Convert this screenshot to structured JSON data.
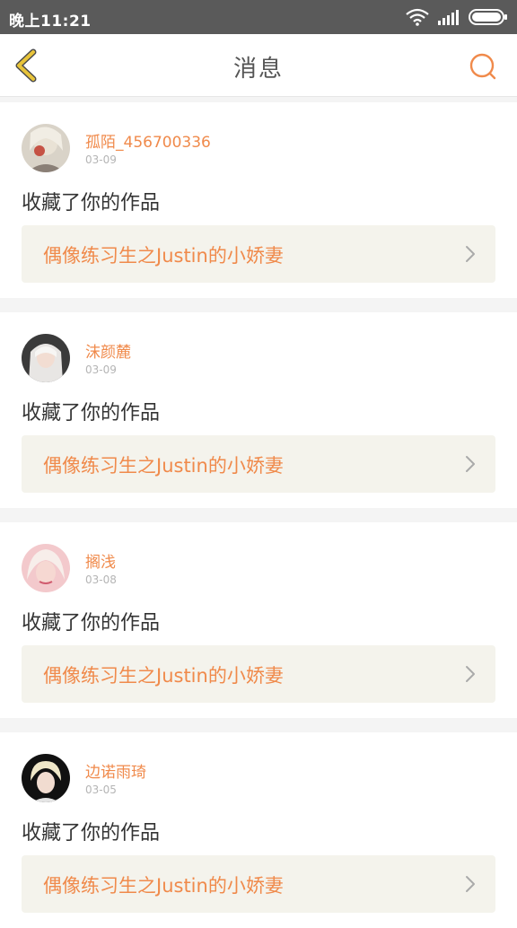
{
  "status_bar": {
    "time": "晚上11:21",
    "icons": [
      "wifi-icon",
      "signal-icon",
      "battery-icon"
    ]
  },
  "header": {
    "title": "消息",
    "back_icon": "chevron-left-icon",
    "search_icon": "search-icon"
  },
  "colors": {
    "accent": "#f08a4b",
    "back": "#e8c43a",
    "card_link_bg": "#f4f3ec"
  },
  "messages": [
    {
      "username": "孤陌_456700336",
      "date": "03-09",
      "action": "收藏了你的作品",
      "work_title": "偶像练习生之Justin的小娇妻"
    },
    {
      "username": "沫颜麓",
      "date": "03-09",
      "action": "收藏了你的作品",
      "work_title": "偶像练习生之Justin的小娇妻"
    },
    {
      "username": "搁浅",
      "date": "03-08",
      "action": "收藏了你的作品",
      "work_title": "偶像练习生之Justin的小娇妻"
    },
    {
      "username": "边诺雨琦",
      "date": "03-05",
      "action": "收藏了你的作品",
      "work_title": "偶像练习生之Justin的小娇妻"
    }
  ]
}
